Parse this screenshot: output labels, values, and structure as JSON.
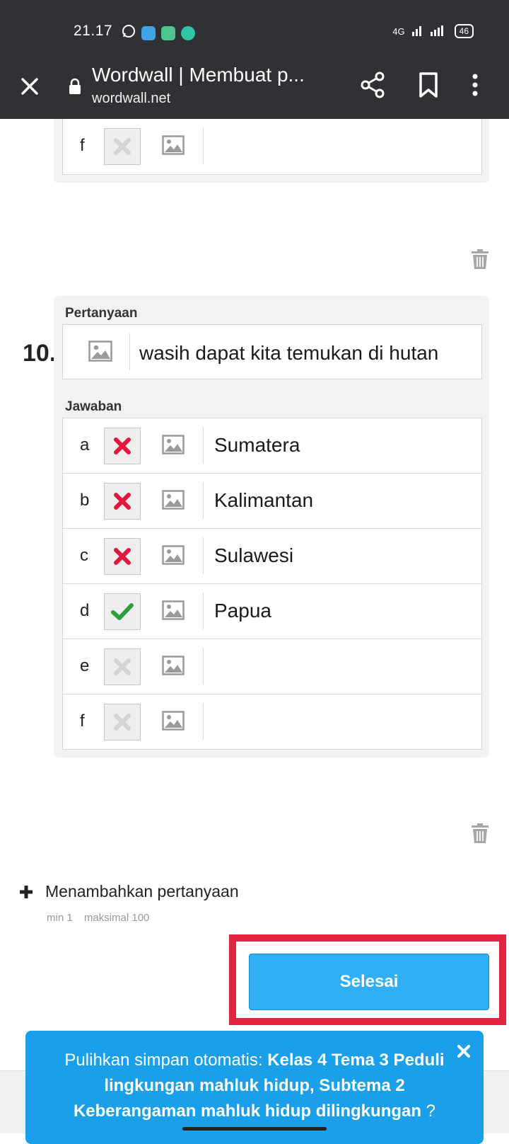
{
  "status_bar": {
    "time": "21.17",
    "network": "4G",
    "battery": "46"
  },
  "browser": {
    "title": "Wordwall | Membuat p...",
    "url": "wordwall.net"
  },
  "prev_card": {
    "row_f_letter": "f"
  },
  "question": {
    "number": "10.",
    "question_label": "Pertanyaan",
    "question_text": "wasih dapat kita temukan di hutan",
    "answers_label": "Jawaban",
    "answers": [
      {
        "letter": "a",
        "text": "Sumatera",
        "state": "wrong"
      },
      {
        "letter": "b",
        "text": "Kalimantan",
        "state": "wrong"
      },
      {
        "letter": "c",
        "text": "Sulawesi",
        "state": "wrong"
      },
      {
        "letter": "d",
        "text": "Papua",
        "state": "correct"
      },
      {
        "letter": "e",
        "text": "",
        "state": "empty"
      },
      {
        "letter": "f",
        "text": "",
        "state": "empty"
      }
    ]
  },
  "add_question": {
    "label": "Menambahkan pertanyaan",
    "min": "min 1",
    "max": "maksimal 100"
  },
  "done_button": {
    "label": "Selesai"
  },
  "banner": {
    "prefix": "Pulihkan simpan otomatis: ",
    "title": "Kelas 4 Tema 3 Peduli lingkungan mahluk hidup, Subtema 2 Keberangaman mahluk hidup dilingkungan",
    "suffix": " ?"
  },
  "colors": {
    "wrong": "#e3163b",
    "correct": "#2e9c3f",
    "empty": "#d0d0d0",
    "button": "#2fb0f4",
    "highlight": "#e3263f",
    "banner": "#1aa0ea"
  }
}
